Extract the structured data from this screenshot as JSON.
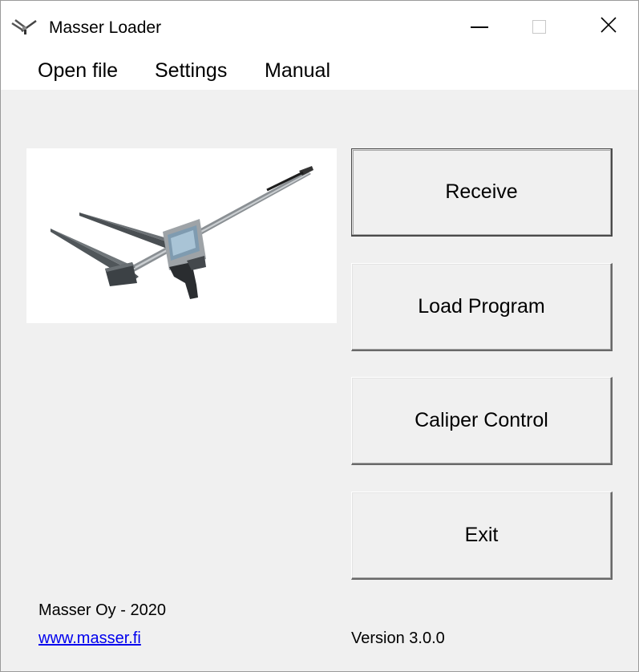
{
  "window": {
    "title": "Masser Loader",
    "app_icon": "caliper-icon"
  },
  "titlebar_controls": {
    "minimize": "minimize-icon",
    "maximize": "maximize-icon",
    "close": "close-icon",
    "close_glyph": "✕"
  },
  "menu": {
    "items": [
      {
        "label": "Open file"
      },
      {
        "label": "Settings"
      },
      {
        "label": "Manual"
      }
    ]
  },
  "buttons": {
    "receive": "Receive",
    "load_program": "Load Program",
    "caliper_control": "Caliper Control",
    "exit": "Exit"
  },
  "footer": {
    "company": "Masser Oy - 2020",
    "website": "www.masser.fi",
    "version": "Version 3.0.0"
  },
  "colors": {
    "background": "#f0f0f0",
    "link": "#0000ee"
  }
}
